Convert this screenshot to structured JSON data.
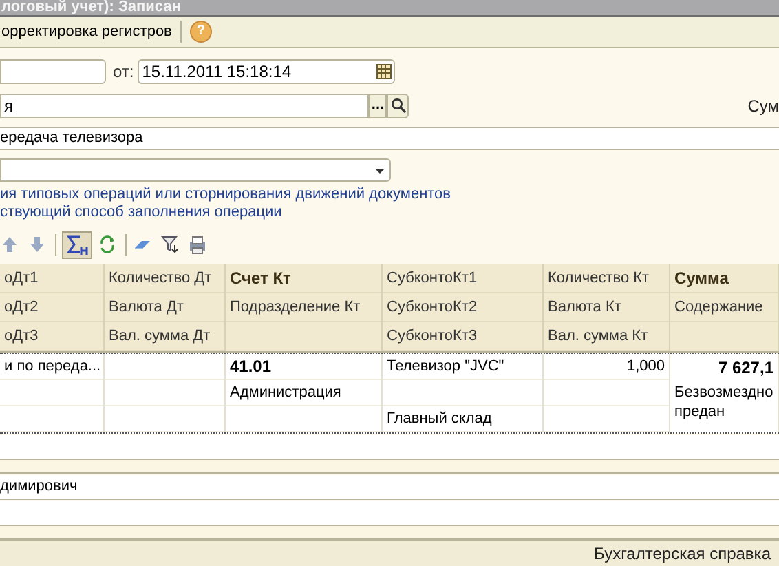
{
  "window": {
    "title": "логовый учет): Записан"
  },
  "toolbar": {
    "items": [
      {
        "kind": "text",
        "label": "орректировка регистров"
      },
      {
        "kind": "help",
        "label": "?"
      }
    ]
  },
  "form": {
    "date_label": "от:",
    "date_field": {
      "value": "15.11.2011 15:18:14"
    },
    "org_field": {
      "value": "я"
    },
    "select_button": "...",
    "sum_label": "Сум",
    "comment_field": {
      "value": "ередача телевизора"
    },
    "links": [
      "ия типовых операций или сторнирования движений документов",
      "ствующий способ заполнения операции"
    ]
  },
  "table_toolbar": {
    "items": [
      {
        "kind": "up",
        "pressed": false
      },
      {
        "kind": "down",
        "pressed": false
      },
      {
        "kind": "sep"
      },
      {
        "kind": "sum",
        "pressed": true
      },
      {
        "kind": "refresh",
        "pressed": false
      },
      {
        "kind": "sep"
      },
      {
        "kind": "eraser",
        "pressed": false
      },
      {
        "kind": "filter",
        "pressed": false
      },
      {
        "kind": "print",
        "pressed": false
      }
    ]
  },
  "table": {
    "columns": [
      {
        "headers": [
          "оДт1",
          "оДт2",
          "оДт3"
        ]
      },
      {
        "headers": [
          "Количество Дт",
          "Валюта Дт",
          "Вал. сумма Дт"
        ]
      },
      {
        "headers": [
          "Счет Кт",
          "Подразделение Кт"
        ]
      },
      {
        "headers": [
          "СубконтоКт1",
          "СубконтоКт2",
          "СубконтоКт3"
        ]
      },
      {
        "headers": [
          "Количество Кт",
          "Валюта Кт",
          "Вал. сумма Кт"
        ]
      },
      {
        "headers": [
          "Сумма",
          "Содержание"
        ]
      }
    ],
    "rows": [
      {
        "cells": [
          {
            "kind": "text",
            "line_1": "и по переда..."
          },
          {
            "kind": "empty"
          },
          {
            "kind": "text",
            "line_1": "41.01",
            "line_2": "Администрация"
          },
          {
            "kind": "text",
            "line_1": "Телевизор \"JVC\"",
            "line_3": "Главный склад"
          },
          {
            "kind": "text",
            "line_1": "1,000"
          },
          {
            "kind": "text",
            "line_1": "7 627,1",
            "line_2": "Безвозмездно\nпредан"
          }
        ]
      }
    ]
  },
  "bottom": {
    "rows": [
      {
        "kind": "white"
      },
      {
        "kind": "band"
      },
      {
        "kind": "white",
        "value": "димирович"
      },
      {
        "kind": "white"
      },
      {
        "kind": "band"
      }
    ]
  },
  "status_bar": {
    "text": "Бухгалтерская справка"
  }
}
